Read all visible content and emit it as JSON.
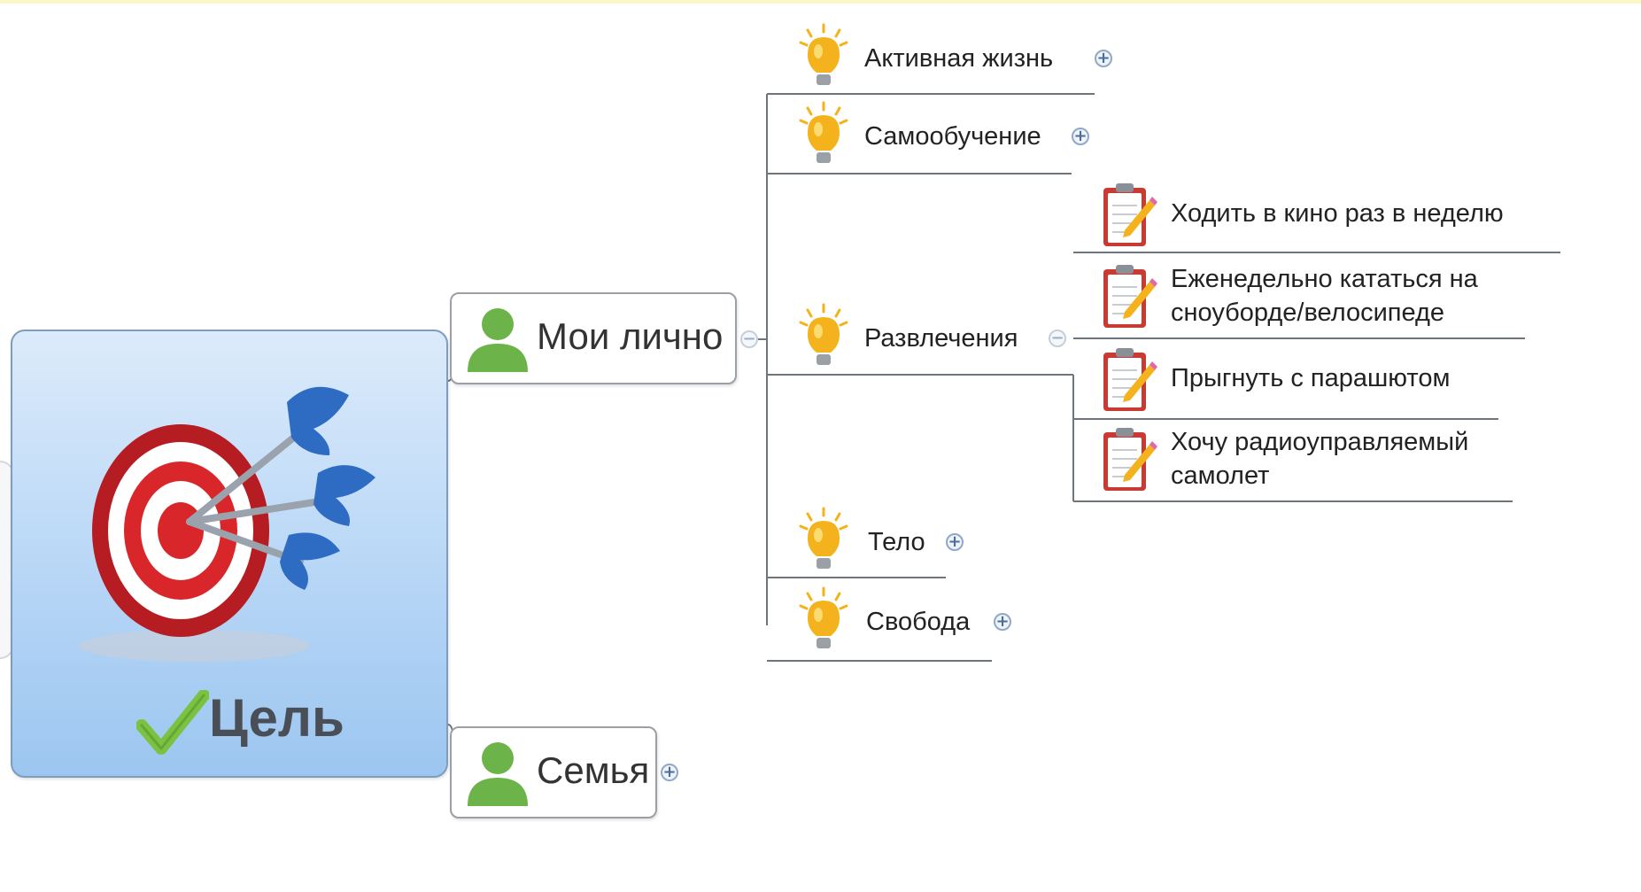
{
  "central": {
    "label": "Цель",
    "icons": [
      "target-dart-icon",
      "checkmark-icon"
    ]
  },
  "branches": [
    {
      "label": "Мои лично",
      "icon": "person-icon",
      "toggle": "−",
      "children": [
        {
          "label": "Активная жизнь",
          "icon": "lightbulb-icon",
          "toggle": "+"
        },
        {
          "label": "Самообучение",
          "icon": "lightbulb-icon",
          "toggle": "+"
        },
        {
          "label": "Развлечения",
          "icon": "lightbulb-icon",
          "toggle": "−",
          "children": [
            {
              "lines": [
                "Ходить в кино раз в неделю"
              ],
              "icon": "clipboard-task-icon"
            },
            {
              "lines": [
                "Еженедельно кататься на",
                "сноуборде/велосипеде"
              ],
              "icon": "clipboard-task-icon"
            },
            {
              "lines": [
                "Прыгнуть с парашютом"
              ],
              "icon": "clipboard-task-icon"
            },
            {
              "lines": [
                "Хочу радиоуправляемый",
                "самолет"
              ],
              "icon": "clipboard-task-icon"
            }
          ]
        },
        {
          "label": "Тело",
          "icon": "lightbulb-icon",
          "toggle": "+"
        },
        {
          "label": "Свобода",
          "icon": "lightbulb-icon",
          "toggle": "+"
        }
      ]
    },
    {
      "label": "Семья",
      "icon": "person-icon",
      "toggle": "+"
    }
  ],
  "colors": {
    "central_fill": "#b7d6f6",
    "connector": "#6f757c",
    "person": "#6cb349",
    "bulb": "#f4b31d",
    "clipboard": "#c93a32",
    "target_red": "#d9262b",
    "dart_blue": "#2e6cc4",
    "check_green": "#7cc242"
  }
}
